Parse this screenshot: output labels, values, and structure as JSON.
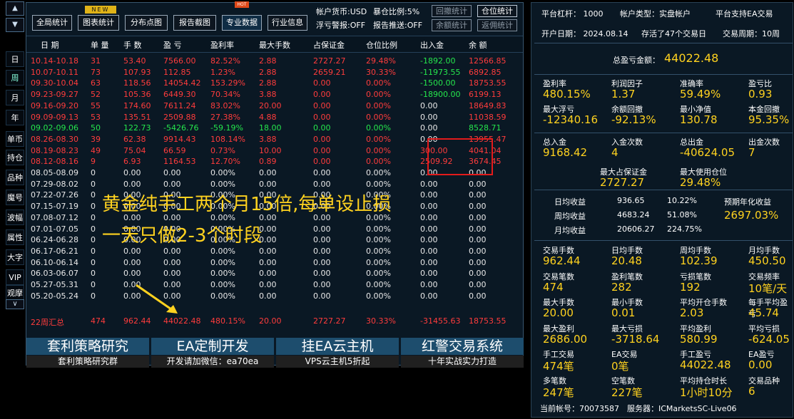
{
  "sidebar": {
    "up": "▲",
    "down": "▼",
    "down2": "∨",
    "items": [
      "日",
      "周",
      "月",
      "年",
      "单币",
      "持仓",
      "品种",
      "魔号",
      "波幅",
      "属性",
      "大字",
      "VIP",
      "观摩"
    ]
  },
  "toolbar": {
    "buttons": [
      "全局统计",
      "图表统计",
      "分布点图",
      "报告截图",
      "专业数据",
      "行业信息"
    ],
    "new_badge": "NEW",
    "hot_badge": "HOT",
    "currency_label": "帐户货币:USD",
    "pos_ratio_label": "暴仓比例:5%",
    "float_warn_label": "浮亏警报:OFF",
    "push_label": "报告推送:OFF",
    "btn_drawdown": "回撤统计",
    "btn_pos": "仓位统计",
    "btn_balance": "余额统计",
    "btn_return": "返佣统计"
  },
  "table": {
    "headers": [
      "日 期",
      "单 量",
      "手 数",
      "盈 亏",
      "盈利率",
      "最大手数",
      "占保证金",
      "仓位比例",
      "出入金",
      "余 额"
    ],
    "rows": [
      {
        "c": "r",
        "d": [
          "10.14-10.18",
          "31",
          "53.40",
          "7566.00",
          "82.52%",
          "2.88",
          "2727.27",
          "29.48%",
          "-1892.00",
          "12566.85"
        ],
        "f": "g"
      },
      {
        "c": "r",
        "d": [
          "10.07-10.11",
          "73",
          "107.93",
          "112.85",
          "1.23%",
          "2.88",
          "2659.21",
          "30.33%",
          "-11973.55",
          "6892.85"
        ],
        "f": "g"
      },
      {
        "c": "r",
        "d": [
          "09.30-10.04",
          "63",
          "118.56",
          "14054.42",
          "153.29%",
          "2.88",
          "0.00",
          "0.00%",
          "-1500.00",
          "18753.55"
        ],
        "f": "g"
      },
      {
        "c": "r",
        "d": [
          "09.23-09.27",
          "52",
          "105.36",
          "6449.30",
          "70.34%",
          "3.88",
          "0.00",
          "0.00%",
          "-18900.00",
          "6199.13"
        ],
        "f": "g"
      },
      {
        "c": "r",
        "d": [
          "09.16-09.20",
          "55",
          "174.60",
          "7611.24",
          "83.02%",
          "20.00",
          "0.00",
          "0.00%",
          "0.00",
          "18649.83"
        ],
        "f": "w"
      },
      {
        "c": "r",
        "d": [
          "09.09-09.13",
          "53",
          "135.51",
          "2509.88",
          "27.38%",
          "4.88",
          "0.00",
          "0.00%",
          "0.00",
          "11038.59"
        ],
        "f": "w"
      },
      {
        "c": "g",
        "d": [
          "09.02-09.06",
          "50",
          "122.73",
          "-5426.76",
          "-59.19%",
          "18.00",
          "0.00",
          "0.00%",
          "0.00",
          "8528.71"
        ],
        "f": "w"
      },
      {
        "c": "r",
        "d": [
          "08.26-08.30",
          "39",
          "62.38",
          "9914.43",
          "108.14%",
          "3.88",
          "0.00",
          "0.00%",
          "0.00",
          "13955.47"
        ],
        "f": "w"
      },
      {
        "c": "r",
        "d": [
          "08.19-08.23",
          "49",
          "75.04",
          "66.59",
          "0.73%",
          "10.00",
          "0.00",
          "0.00%",
          "300.00",
          "4041.04"
        ],
        "f": "r"
      },
      {
        "c": "r",
        "d": [
          "08.12-08.16",
          "9",
          "6.93",
          "1164.53",
          "12.70%",
          "0.89",
          "0.00",
          "0.00%",
          "2509.92",
          "3674.45"
        ],
        "f": "r"
      },
      {
        "c": "w",
        "d": [
          "08.05-08.09",
          "0",
          "0.00",
          "0.00",
          "0.00%",
          "0.00",
          "0.00",
          "0.00%",
          "0.00",
          "0.00"
        ],
        "f": "w"
      },
      {
        "c": "w",
        "d": [
          "07.29-08.02",
          "0",
          "0.00",
          "0.00",
          "0.00%",
          "0.00",
          "0.00",
          "0.00%",
          "0.00",
          "0.00"
        ],
        "f": "w"
      },
      {
        "c": "w",
        "d": [
          "07.22-07.26",
          "0",
          "0.00",
          "0.00",
          "0.00%",
          "0.00",
          "0.00",
          "0.00%",
          "0.00",
          "0.00"
        ],
        "f": "w"
      },
      {
        "c": "w",
        "d": [
          "07.15-07.19",
          "0",
          "0.00",
          "0.00",
          "0.00%",
          "0.00",
          "0.00",
          "0.00%",
          "0.00",
          "0.00"
        ],
        "f": "w"
      },
      {
        "c": "w",
        "d": [
          "07.08-07.12",
          "0",
          "0.00",
          "0.00",
          "0.00%",
          "0.00",
          "0.00",
          "0.00%",
          "0.00",
          "0.00"
        ],
        "f": "w"
      },
      {
        "c": "w",
        "d": [
          "07.01-07.05",
          "0",
          "0.00",
          "0.00",
          "0.00%",
          "0.00",
          "0.00",
          "0.00%",
          "0.00",
          "0.00"
        ],
        "f": "w"
      },
      {
        "c": "w",
        "d": [
          "06.24-06.28",
          "0",
          "0.00",
          "0.00",
          "0.00%",
          "0.00",
          "0.00",
          "0.00%",
          "0.00",
          "0.00"
        ],
        "f": "w"
      },
      {
        "c": "w",
        "d": [
          "06.17-06.21",
          "0",
          "0.00",
          "0.00",
          "0.00%",
          "0.00",
          "0.00",
          "0.00%",
          "0.00",
          "0.00"
        ],
        "f": "w"
      },
      {
        "c": "w",
        "d": [
          "06.10-06.14",
          "0",
          "0.00",
          "0.00",
          "0.00%",
          "0.00",
          "0.00",
          "0.00%",
          "0.00",
          "0.00"
        ],
        "f": "w"
      },
      {
        "c": "w",
        "d": [
          "06.03-06.07",
          "0",
          "0.00",
          "0.00",
          "0.00%",
          "0.00",
          "0.00",
          "0.00%",
          "0.00",
          "0.00"
        ],
        "f": "w"
      },
      {
        "c": "w",
        "d": [
          "05.27-05.31",
          "0",
          "0.00",
          "0.00",
          "0.00%",
          "0.00",
          "0.00",
          "0.00%",
          "0.00",
          "0.00"
        ],
        "f": "w"
      },
      {
        "c": "w",
        "d": [
          "05.20-05.24",
          "0",
          "0.00",
          "0.00",
          "0.00%",
          "0.00",
          "0.00",
          "0.00%",
          "0.00",
          "0.00"
        ],
        "f": "w"
      }
    ],
    "summary": [
      "22周汇总",
      "474",
      "962.44",
      "44022.48",
      "480.15%",
      "20.00",
      "2727.27",
      "30.33%",
      "-31455.63",
      "18753.55"
    ]
  },
  "overlay": {
    "line1": "黄金纯手工两个月15倍,每单设止损",
    "line2": "一天只做2-3个时段"
  },
  "banners": [
    {
      "title": "套利策略研究",
      "sub": "套利策略研究群"
    },
    {
      "title": "EA定制开发",
      "sub": "开发请加微信：ea70ea"
    },
    {
      "title": "挂EA云主机",
      "sub": "VPS云主机5折起"
    },
    {
      "title": "红警交易系统",
      "sub": "十年实战实力打造"
    }
  ],
  "right": {
    "leverage_label": "平台杠杆：",
    "leverage": "1000",
    "acct_type_label": "帐户类型：",
    "acct_type": "实盘帐户",
    "ea_support": "平台支持EA交易",
    "open_date_label": "开户日期：",
    "open_date": "2024.08.14",
    "alive": "存活了47个交易日",
    "period_label": "交易周期：",
    "period": "10周",
    "total_pl_label": "总盈亏金额：",
    "total_pl": "44022.48",
    "stats1": [
      [
        "盈利率",
        "480.15%"
      ],
      [
        "利润因子",
        "1.37"
      ],
      [
        "准确率",
        "59.49%"
      ],
      [
        "盈亏比",
        "0.93"
      ],
      [
        "最大浮亏",
        "-12340.16"
      ],
      [
        "余额回撤",
        "-92.13%"
      ],
      [
        "最小净值",
        "130.78"
      ],
      [
        "本金回撤",
        "95.35%"
      ]
    ],
    "stats2": [
      [
        "总入金",
        "9168.42"
      ],
      [
        "入金次数",
        "4"
      ],
      [
        "总出金",
        "-40624.05"
      ],
      [
        "出金次数",
        "7"
      ]
    ],
    "stats2b": [
      [
        "最大占保证金",
        "2727.27"
      ],
      [
        "最大使用仓位",
        "29.48%"
      ]
    ],
    "avg": [
      [
        "日均收益",
        "936.65",
        "10.22%"
      ],
      [
        "周均收益",
        "4683.24",
        "51.08%"
      ],
      [
        "月均收益",
        "20606.27",
        "224.75%"
      ]
    ],
    "annual_label": "预期年化收益",
    "annual": "2697.03%",
    "stats3": [
      [
        "交易手数",
        "962.44"
      ],
      [
        "日均手数",
        "20.48"
      ],
      [
        "周均手数",
        "102.39"
      ],
      [
        "月均手数",
        "450.50"
      ],
      [
        "交易笔数",
        "474"
      ],
      [
        "盈利笔数",
        "282"
      ],
      [
        "亏损笔数",
        "192"
      ],
      [
        "交易频率",
        "10笔/天"
      ],
      [
        "最大手数",
        "20.00"
      ],
      [
        "最小手数",
        "0.01"
      ],
      [
        "平均开仓手数",
        "2.03"
      ],
      [
        "每手平均盈亏",
        "45.74"
      ],
      [
        "最大盈利",
        "2686.00"
      ],
      [
        "最大亏损",
        "-3718.64"
      ],
      [
        "平均盈利",
        "580.99"
      ],
      [
        "平均亏损",
        "-624.05"
      ],
      [
        "手工交易",
        "474笔"
      ],
      [
        "EA交易",
        "0笔"
      ],
      [
        "手工盈亏",
        "44022.48"
      ],
      [
        "EA盈亏",
        "0.00"
      ],
      [
        "多笔数",
        "247笔"
      ],
      [
        "空笔数",
        "227笔"
      ],
      [
        "平均持仓时长",
        "1小时10分"
      ],
      [
        "交易品种",
        "6"
      ]
    ],
    "acct_no_label": "当前帐号：",
    "acct_no": "70073587",
    "server_label": "服务器：",
    "server": "ICMarketsSC-Live06"
  }
}
